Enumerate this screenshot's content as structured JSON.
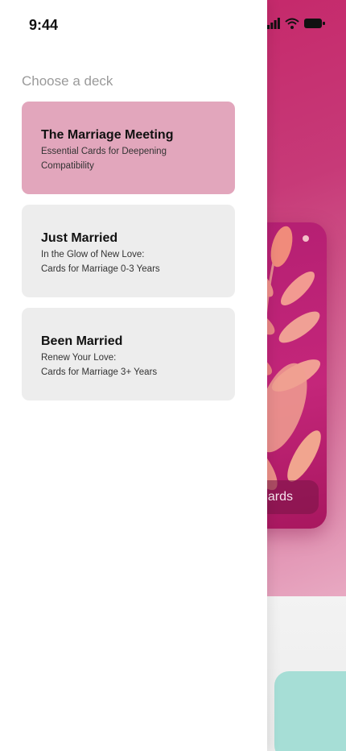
{
  "status_bar": {
    "time": "9:44"
  },
  "drawer": {
    "title": "Choose a deck",
    "decks": [
      {
        "title": "The Marriage Meeting",
        "subtitle_line1": "Essential Cards for Deepening",
        "subtitle_line2": "Compatibility",
        "selected": true
      },
      {
        "title": "Just Married",
        "subtitle_line1": "In the Glow of New Love:",
        "subtitle_line2": "Cards for Marriage 0-3 Years",
        "selected": false
      },
      {
        "title": "Been Married",
        "subtitle_line1": "Renew Your Love:",
        "subtitle_line2": "Cards for Marriage 3+ Years",
        "selected": false
      }
    ]
  },
  "background": {
    "card_button_label": "ards"
  },
  "colors": {
    "selected_deck": "#e2a6bc",
    "deck_default": "#ededed",
    "hero_accent": "#c42165",
    "teal": "#a6ded6"
  },
  "icons": [
    "signal-icon",
    "wifi-icon",
    "battery-icon"
  ]
}
